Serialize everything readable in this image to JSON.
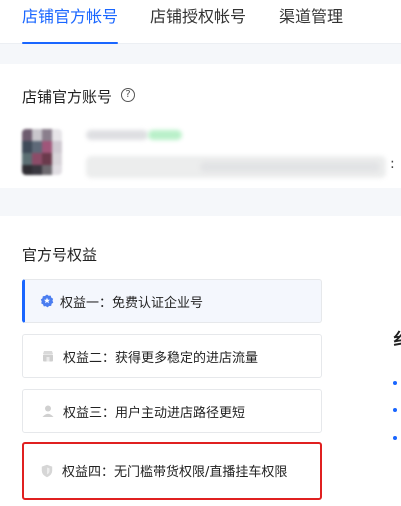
{
  "tabs": [
    {
      "label": "店铺官方帐号",
      "active": true
    },
    {
      "label": "店铺授权帐号",
      "active": false
    },
    {
      "label": "渠道管理",
      "active": false
    }
  ],
  "official_account": {
    "title": "店铺官方账号",
    "help_icon": "question-circle-icon",
    "colon": ":"
  },
  "benefits": {
    "title": "官方号权益",
    "items": [
      {
        "label": "权益一：免费认证企业号",
        "icon": "verified-badge-icon",
        "active": true
      },
      {
        "label": "权益二：获得更多稳定的进店流量",
        "icon": "store-icon",
        "active": false
      },
      {
        "label": "权益三：用户主动进店路径更短",
        "icon": "user-icon",
        "active": false
      },
      {
        "label": "权益四：无门槛带货权限/直播挂车权限",
        "icon": "shield-icon",
        "active": false
      }
    ]
  },
  "colors": {
    "accent": "#1966ff",
    "highlight_border": "#e02020"
  }
}
